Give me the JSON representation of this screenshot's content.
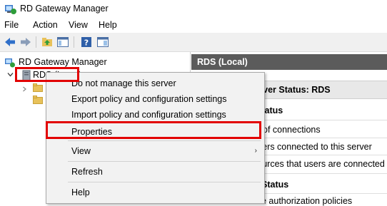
{
  "window": {
    "title": "RD Gateway Manager"
  },
  "menu": [
    "File",
    "Action",
    "View",
    "Help"
  ],
  "tree": {
    "root": "RD Gateway Manager",
    "node": "RDS (Local)"
  },
  "right_pane": {
    "header": "RDS (Local)",
    "band": "Server Status: RDS",
    "section1": "Status",
    "line1": "of connections",
    "line2": "users connected to this server",
    "line3": "sources that users are connected to",
    "section2": "Status",
    "line4": "e authorization policies"
  },
  "context_menu": {
    "items": [
      "Do not manage this server",
      "Export policy and configuration settings",
      "Import policy and configuration settings",
      "Properties",
      "View",
      "Refresh",
      "Help"
    ],
    "submenu_arrow": "›"
  },
  "colors": {
    "highlight": "#e20000",
    "header_bg": "#5b5b5b",
    "menu_bg": "#f2f2f2"
  }
}
